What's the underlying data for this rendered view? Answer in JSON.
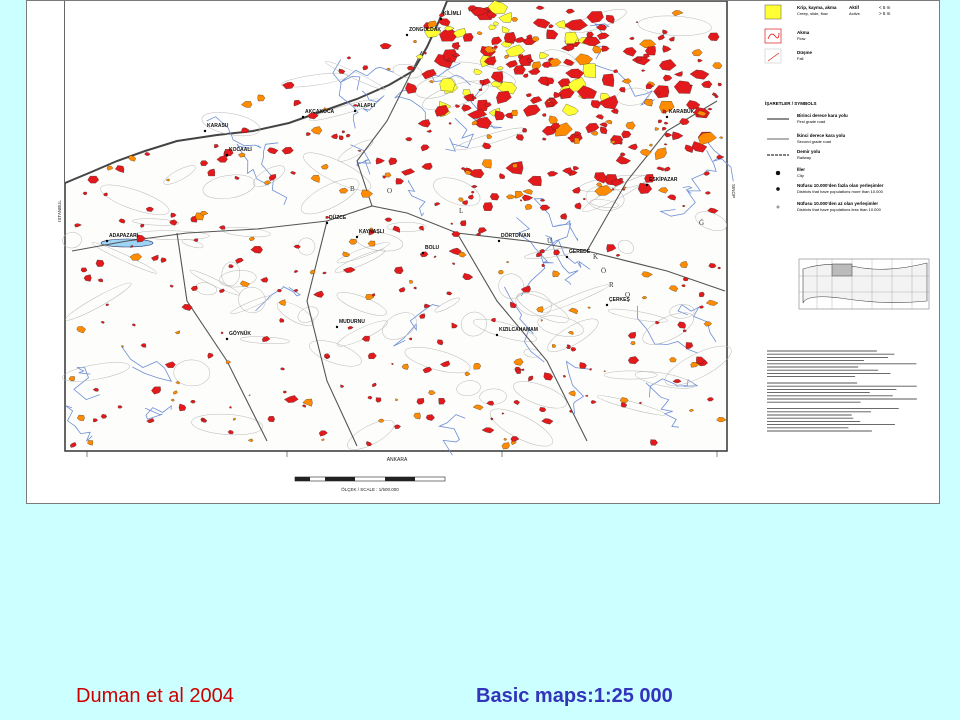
{
  "slide": {
    "background": "#ccffff",
    "caption_left": "Duman et al 2004",
    "caption_right": "Basic maps:1:25 000",
    "caption_left_color": "#cc0000",
    "caption_right_color": "#3333bb"
  },
  "map": {
    "border_labels": {
      "bottom": "ANKARA",
      "left": "ISTANBUL",
      "right": "SINOP"
    },
    "scale_bar": {
      "title": "ÖLÇEK / SCALE : 1/500.000"
    },
    "places": [
      "ZONGULDAK",
      "KİLİMLİ",
      "KARABÜK",
      "KARASU",
      "AKÇAKOCA",
      "ALAPLI",
      "KOCAALİ",
      "DÜZCE",
      "BOLU",
      "ADAPAZARI",
      "KAYNAŞLI",
      "GÖYNÜK",
      "MUDURNU",
      "DÖRTDİVAN",
      "GEREDE",
      "ÇERKEŞ",
      "KIZILCAHAMAM",
      "ESKİPAZAR"
    ],
    "range_letters": [
      "B",
      "O",
      "L",
      "U",
      "K",
      "Ö",
      "R",
      "O",
      "Ğ"
    ],
    "legend": {
      "items": [
        {
          "tr": "Krip, kayma, akma",
          "en": "Creep, slide, flow",
          "status_tr": "Aktif",
          "status_en": "Active",
          "depth_deep": "< 5 m",
          "depth_shallow": "> 5 m",
          "color": "#ffff33"
        },
        {
          "tr": "Akma",
          "en": "Flow",
          "color": "#ff3333"
        },
        {
          "tr": "Düşme",
          "en": "Fall",
          "color": "#ff3333"
        }
      ],
      "symbols_title": "İŞARETLER / SYMBOLS",
      "symbols": [
        {
          "tr": "Birinci derece kara yolu",
          "en": "First grade road"
        },
        {
          "tr": "İkinci derece kara yolu",
          "en": "Second grade road"
        },
        {
          "tr": "Demir yolu",
          "en": "Railway"
        },
        {
          "tr": "İller",
          "en": "City"
        },
        {
          "tr": "Nüfusu 10.000'den fazla olan yerleşimler",
          "en": "Districts that have populations more than 10.000"
        },
        {
          "tr": "Nüfusu 10.000'den az olan yerleşimler",
          "en": "Districts that have populations less than 10.000"
        }
      ]
    },
    "colors": {
      "landslide_red": "#e31a1c",
      "landslide_orange": "#ff8c00",
      "landslide_yellow": "#ffff33",
      "sea_blue": "#bfe6ff"
    }
  }
}
